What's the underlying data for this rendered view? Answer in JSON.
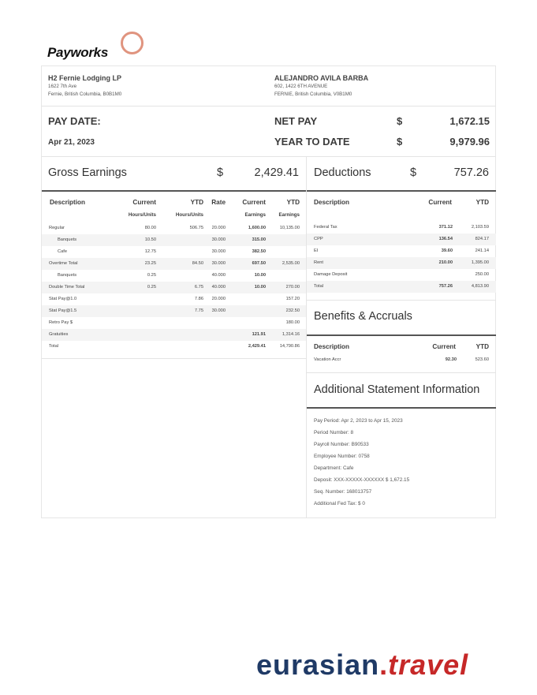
{
  "logo": {
    "text": "Payworks"
  },
  "employer": {
    "name": "H2 Fernie Lodging LP",
    "address1": "1622 7th Ave",
    "address2": "Fernie, British Columbia, B0B1M0"
  },
  "employee": {
    "name": "ALEJANDRO AVILA BARBA",
    "address1": "602, 1422 6TH AVENUE",
    "address2": "FERNIE, British Columbia, V0B1M0"
  },
  "summary": {
    "pay_date_label": "PAY DATE:",
    "pay_date": "Apr 21, 2023",
    "net_pay_label": "NET PAY",
    "net_pay_currency": "$",
    "net_pay": "1,672.15",
    "ytd_label": "YEAR TO DATE",
    "ytd_currency": "$",
    "ytd": "9,979.96"
  },
  "gross": {
    "title": "Gross Earnings",
    "currency": "$",
    "amount": "2,429.41",
    "headers": {
      "description": "Description",
      "current": "Current",
      "current_sub": "Hours/Units",
      "ytd": "YTD",
      "ytd_sub": "Hours/Units",
      "rate": "Rate",
      "earn_current": "Current",
      "earn_current_sub": "Earnings",
      "earn_ytd": "YTD",
      "earn_ytd_sub": "Earnings"
    },
    "rows": [
      {
        "desc": "Regular",
        "cur": "80.00",
        "ytd": "506.75",
        "rate": "20.000",
        "ecur": "1,600.00",
        "eytd": "10,135.00"
      },
      {
        "desc": "Banquets",
        "cur": "10.50",
        "ytd": "",
        "rate": "30.000",
        "ecur": "315.00",
        "eytd": ""
      },
      {
        "desc": "Cafe",
        "cur": "12.75",
        "ytd": "",
        "rate": "30.000",
        "ecur": "382.50",
        "eytd": ""
      },
      {
        "desc": "Overtime Total",
        "cur": "23.25",
        "ytd": "84.50",
        "rate": "30.000",
        "ecur": "697.50",
        "eytd": "2,535.00"
      },
      {
        "desc": "Banquets",
        "cur": "0.25",
        "ytd": "",
        "rate": "40.000",
        "ecur": "10.00",
        "eytd": ""
      },
      {
        "desc": "Double Time Total",
        "cur": "0.25",
        "ytd": "6.75",
        "rate": "40.000",
        "ecur": "10.00",
        "eytd": "270.00"
      },
      {
        "desc": "Stat Pay@1.0",
        "cur": "",
        "ytd": "7.86",
        "rate": "20.000",
        "ecur": "",
        "eytd": "157.20"
      },
      {
        "desc": "Stat Pay@1.5",
        "cur": "",
        "ytd": "7.75",
        "rate": "30.000",
        "ecur": "",
        "eytd": "232.50"
      },
      {
        "desc": "Retro Pay $",
        "cur": "",
        "ytd": "",
        "rate": "",
        "ecur": "",
        "eytd": "180.00"
      },
      {
        "desc": "Gratuities",
        "cur": "",
        "ytd": "",
        "rate": "",
        "ecur": "121.91",
        "eytd": "1,314.16"
      },
      {
        "desc": "Total",
        "cur": "",
        "ytd": "",
        "rate": "",
        "ecur": "2,429.41",
        "eytd": "14,790.86"
      }
    ]
  },
  "deductions": {
    "title": "Deductions",
    "currency": "$",
    "amount": "757.26",
    "headers": {
      "description": "Description",
      "current": "Current",
      "ytd": "YTD"
    },
    "rows": [
      {
        "desc": "Federal Tax",
        "cur": "371.12",
        "ytd": "2,103.59"
      },
      {
        "desc": "CPP",
        "cur": "136.54",
        "ytd": "824.17"
      },
      {
        "desc": "EI",
        "cur": "39.60",
        "ytd": "241.14"
      },
      {
        "desc": "Rent",
        "cur": "210.00",
        "ytd": "1,395.00"
      },
      {
        "desc": "Damage Deposit",
        "cur": "",
        "ytd": "250.00"
      },
      {
        "desc": "Total",
        "cur": "757.26",
        "ytd": "4,813.90"
      }
    ]
  },
  "benefits": {
    "title": "Benefits & Accruals",
    "headers": {
      "description": "Description",
      "current": "Current",
      "ytd": "YTD"
    },
    "rows": [
      {
        "desc": "Vacation Accr",
        "cur": "92.30",
        "ytd": "523.60"
      }
    ]
  },
  "additional": {
    "title": "Additional Statement Information",
    "lines": [
      "Pay Period: Apr 2, 2023 to Apr 15, 2023",
      "Period Number: 8",
      "Payroll Number: B90533",
      "Employee Number: 0758",
      "Department: Cafe",
      "Deposit: XXX-XXXXX-XXXXXX $ 1,672.15",
      "Seq. Number: 168013757",
      "Additional Fed Tax: $ 0"
    ]
  },
  "brand": {
    "name": "eurasian",
    "dot": ".",
    "tld": "travel"
  }
}
